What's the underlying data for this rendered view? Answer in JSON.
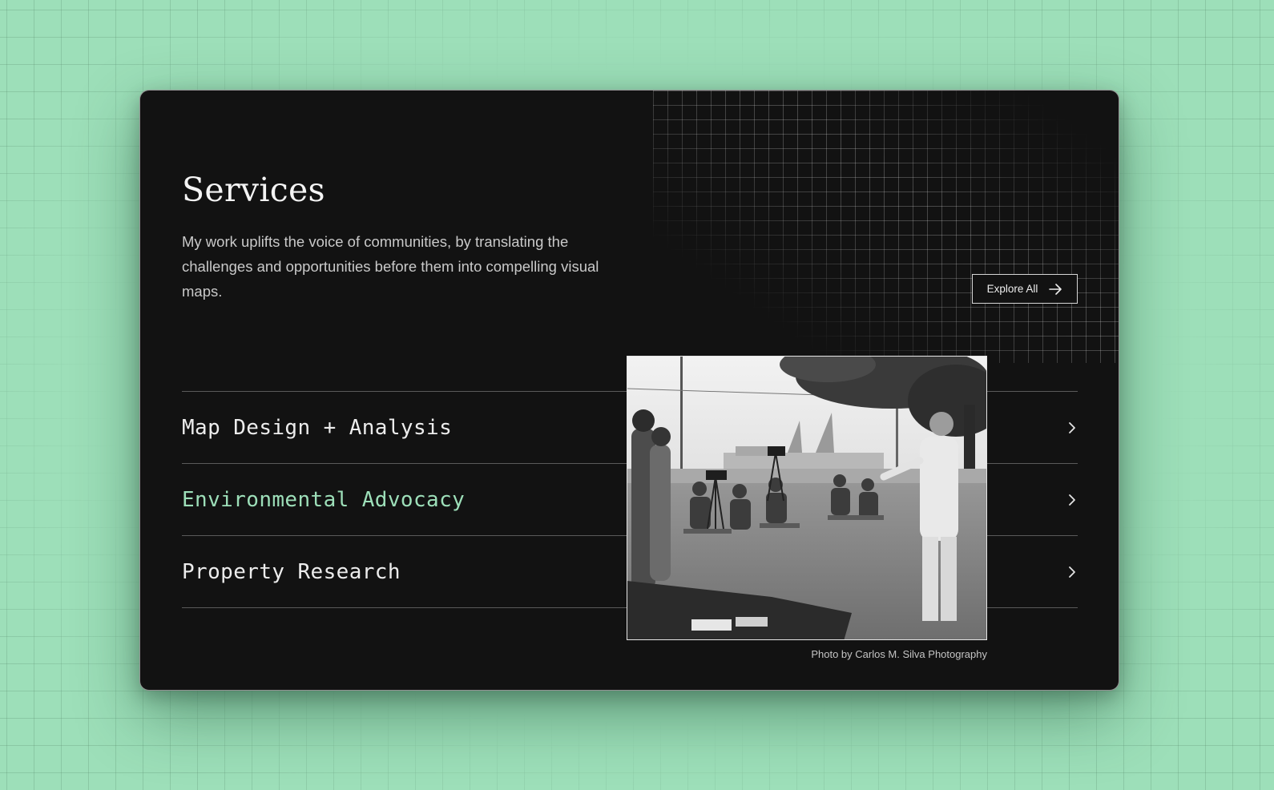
{
  "section": {
    "title": "Services",
    "intro": "My work uplifts the voice of communities, by translating the challenges and opportunities before them into compelling visual maps.",
    "explore_label": "Explore All"
  },
  "services": [
    {
      "label": "Map Design + Analysis",
      "active": false
    },
    {
      "label": "Environmental Advocacy",
      "active": true
    },
    {
      "label": "Property Research",
      "active": false
    }
  ],
  "photo": {
    "caption": "Photo by Carlos M. Silva Photography"
  },
  "colors": {
    "page_background": "#9ddfb9",
    "card_background": "#121212",
    "accent": "#9ddfb9",
    "text": "#ececec"
  },
  "icons": {
    "explore": "arrow-right-icon",
    "row": "chevron-right-icon"
  }
}
